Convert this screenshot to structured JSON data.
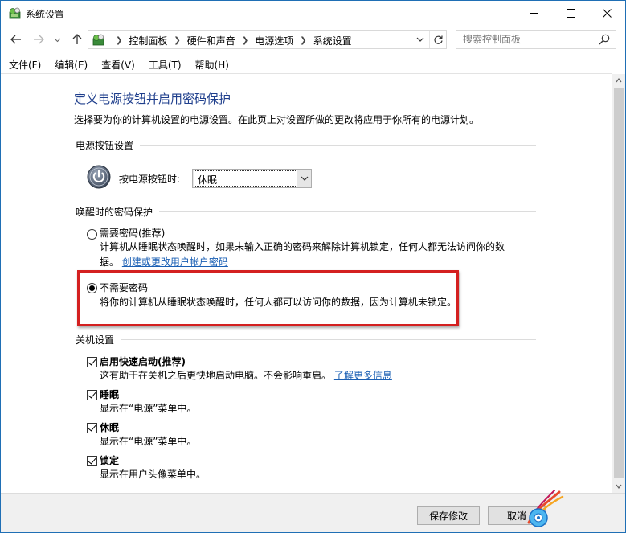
{
  "window": {
    "title": "系统设置",
    "minimize": "minimize",
    "maximize": "maximize",
    "close": "close"
  },
  "address_bar": {
    "breadcrumbs": [
      "控制面板",
      "硬件和声音",
      "电源选项",
      "系统设置"
    ]
  },
  "search": {
    "placeholder": "搜索控制面板"
  },
  "menu": [
    "文件(F)",
    "编辑(E)",
    "查看(V)",
    "工具(T)",
    "帮助(H)"
  ],
  "page": {
    "title": "定义电源按钮并启用密码保护",
    "description": "选择要为你的计算机设置的电源设置。在此页上对设置所做的更改将应用于你所有的电源计划。"
  },
  "power_buttons": {
    "section": "电源按钮设置",
    "label": "按电源按钮时:",
    "selected": "休眠"
  },
  "wake_password": {
    "section": "唤醒时的密码保护",
    "options": [
      {
        "label": "需要密码(推荐)",
        "desc_line1": "计算机从睡眠状态唤醒时，如果未输入正确的密码来解除计算机锁定，任何人都无法访问你的数",
        "desc_line2": "据。",
        "link": "创建或更改用户帐户密码",
        "checked": false
      },
      {
        "label": "不需要密码",
        "desc_line1": "将你的计算机从睡眠状态唤醒时，任何人都可以访问你的数据，因为计算机未锁定。",
        "checked": true
      }
    ]
  },
  "shutdown": {
    "section": "关机设置",
    "items": [
      {
        "label": "启用快速启动(推荐)",
        "desc": "这有助于在关机之后更快地启动电脑。不会影响重启。",
        "link": "了解更多信息",
        "checked": true
      },
      {
        "label": "睡眠",
        "desc": "显示在“电源”菜单中。",
        "checked": true
      },
      {
        "label": "休眠",
        "desc": "显示在“电源”菜单中。",
        "checked": true
      },
      {
        "label": "锁定",
        "desc": "显示在用户头像菜单中。",
        "checked": true
      }
    ]
  },
  "footer": {
    "save": "保存修改",
    "cancel": "取消"
  },
  "colors": {
    "title_blue": "#1e3e8c",
    "link_blue": "#1a5fb4",
    "highlight_red": "#d42020"
  }
}
